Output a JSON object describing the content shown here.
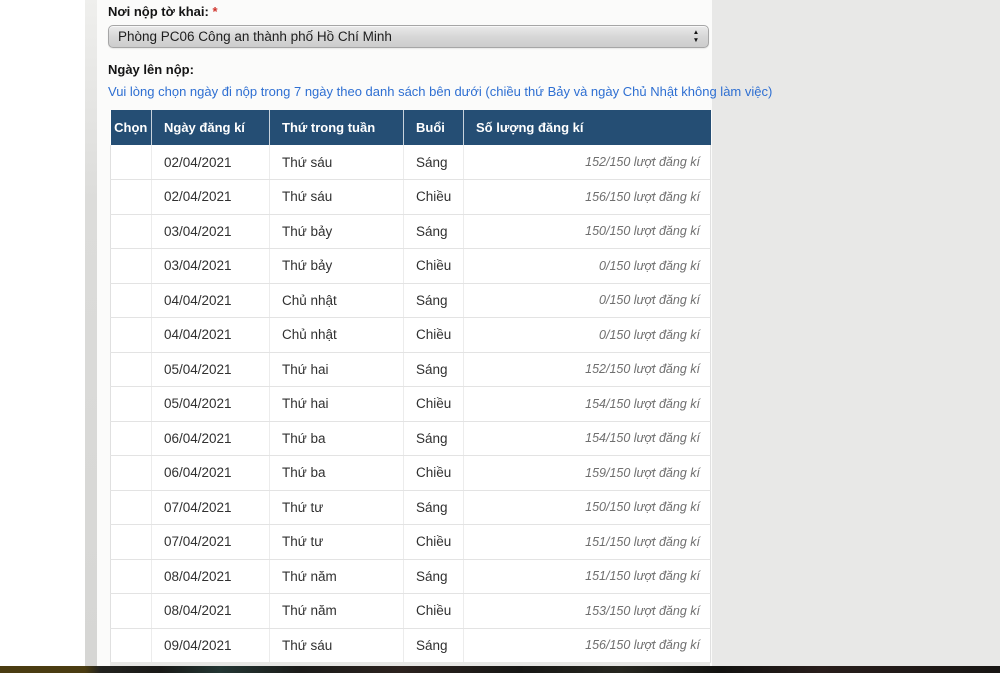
{
  "form": {
    "place_label": "Nơi nộp tờ khai:",
    "required_mark": "*",
    "place_value": "Phòng PC06 Công an thành phố Hồ Chí Minh",
    "date_label": "Ngày lên nộp:",
    "note": "Vui lòng chọn ngày đi nộp trong 7 ngày theo danh sách bên dưới (chiều thứ Bảy và ngày Chủ Nhật không làm việc)"
  },
  "icons": {
    "select_stepper_up": "▲",
    "select_stepper_down": "▼"
  },
  "table": {
    "headers": [
      "Chọn",
      "Ngày đăng kí",
      "Thứ trong tuần",
      "Buổi",
      "Số lượng đăng kí"
    ],
    "rows": [
      {
        "date": "02/04/2021",
        "weekday": "Thứ sáu",
        "session": "Sáng",
        "count": "152/150 lượt đăng kí"
      },
      {
        "date": "02/04/2021",
        "weekday": "Thứ sáu",
        "session": "Chiều",
        "count": "156/150 lượt đăng kí"
      },
      {
        "date": "03/04/2021",
        "weekday": "Thứ bảy",
        "session": "Sáng",
        "count": "150/150 lượt đăng kí"
      },
      {
        "date": "03/04/2021",
        "weekday": "Thứ bảy",
        "session": "Chiều",
        "count": "0/150 lượt đăng kí"
      },
      {
        "date": "04/04/2021",
        "weekday": "Chủ nhật",
        "session": "Sáng",
        "count": "0/150 lượt đăng kí"
      },
      {
        "date": "04/04/2021",
        "weekday": "Chủ nhật",
        "session": "Chiều",
        "count": "0/150 lượt đăng kí"
      },
      {
        "date": "05/04/2021",
        "weekday": "Thứ hai",
        "session": "Sáng",
        "count": "152/150 lượt đăng kí"
      },
      {
        "date": "05/04/2021",
        "weekday": "Thứ hai",
        "session": "Chiều",
        "count": "154/150 lượt đăng kí"
      },
      {
        "date": "06/04/2021",
        "weekday": "Thứ ba",
        "session": "Sáng",
        "count": "154/150 lượt đăng kí"
      },
      {
        "date": "06/04/2021",
        "weekday": "Thứ ba",
        "session": "Chiều",
        "count": "159/150 lượt đăng kí"
      },
      {
        "date": "07/04/2021",
        "weekday": "Thứ tư",
        "session": "Sáng",
        "count": "150/150 lượt đăng kí"
      },
      {
        "date": "07/04/2021",
        "weekday": "Thứ tư",
        "session": "Chiều",
        "count": "151/150 lượt đăng kí"
      },
      {
        "date": "08/04/2021",
        "weekday": "Thứ năm",
        "session": "Sáng",
        "count": "151/150 lượt đăng kí"
      },
      {
        "date": "08/04/2021",
        "weekday": "Thứ năm",
        "session": "Chiều",
        "count": "153/150 lượt đăng kí"
      },
      {
        "date": "09/04/2021",
        "weekday": "Thứ sáu",
        "session": "Sáng",
        "count": "156/150 lượt đăng kí"
      }
    ]
  },
  "colors": {
    "header_bg": "#254e74",
    "note_blue": "#2e6fd2",
    "required_red": "#d0342c",
    "count_gray": "#6f6f6f",
    "page_side_bg": "#e8e8e7"
  }
}
